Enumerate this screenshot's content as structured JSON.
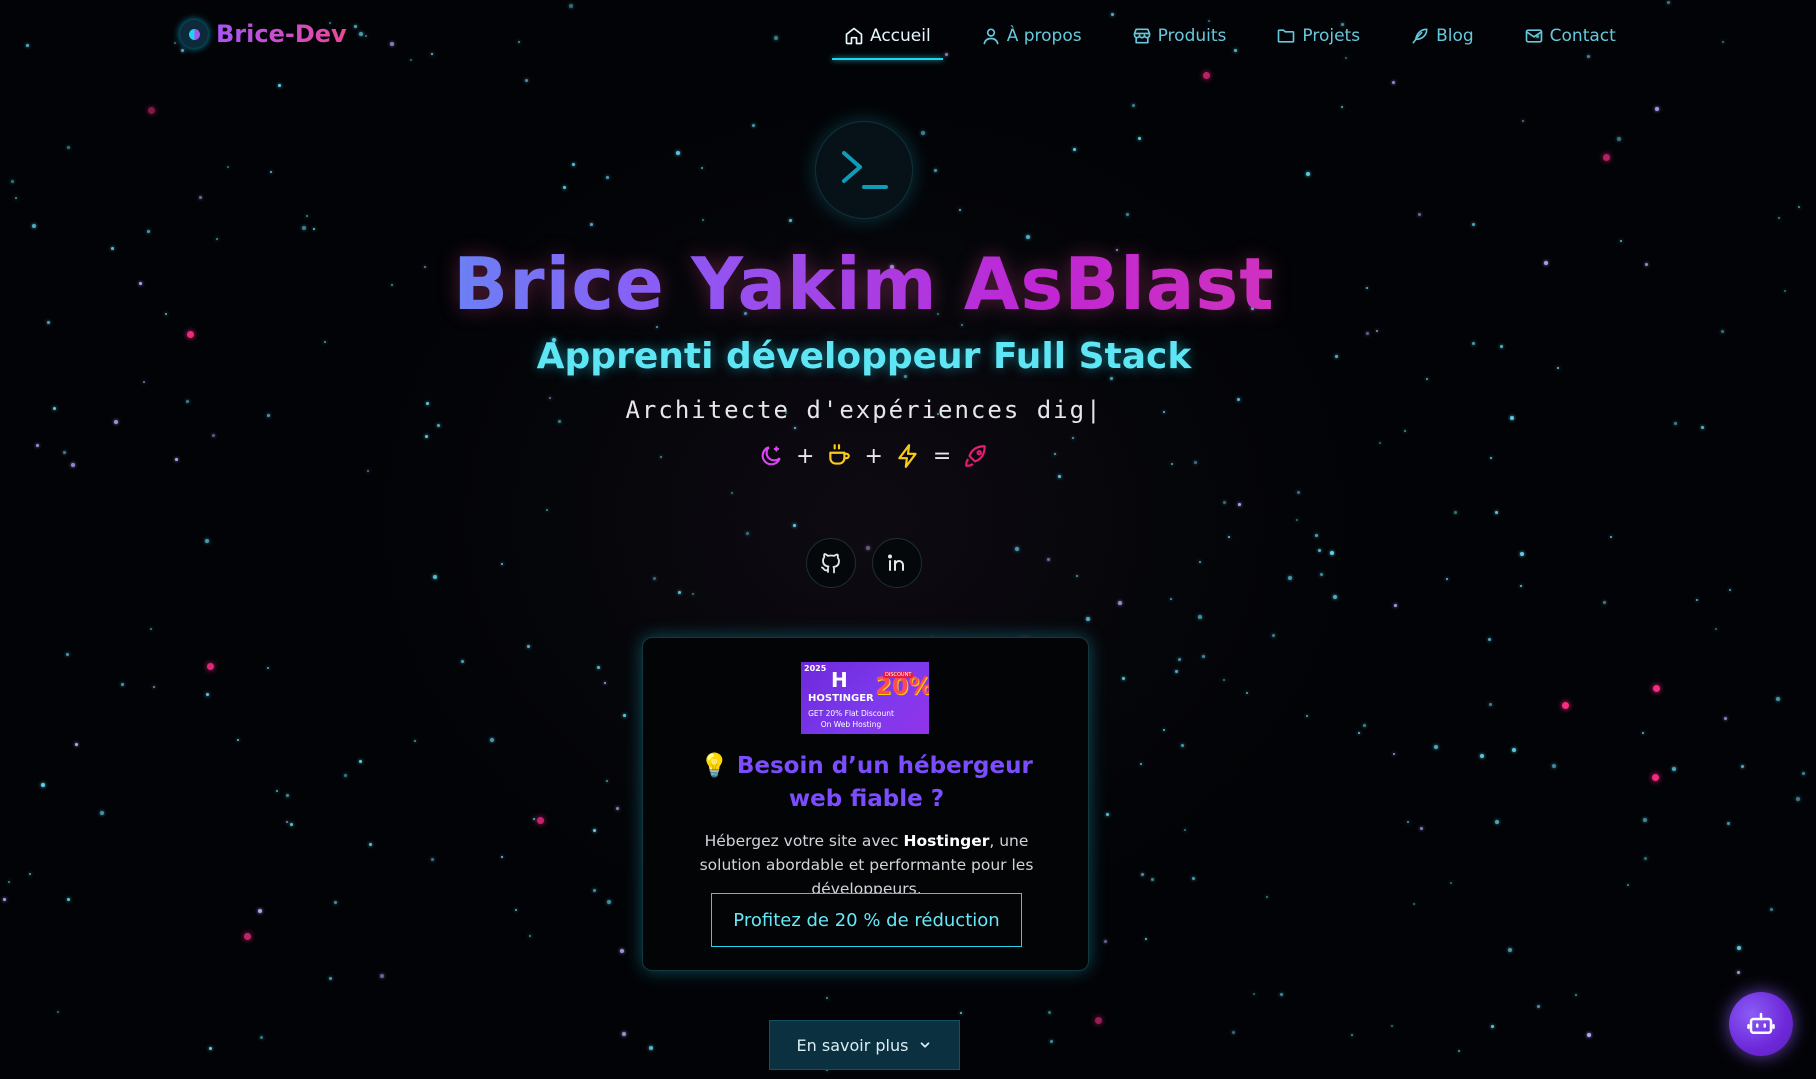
{
  "brand": {
    "name": "Brice-Dev"
  },
  "nav": {
    "items": [
      {
        "label": "Accueil",
        "icon": "home-icon",
        "active": true
      },
      {
        "label": "À propos",
        "icon": "user-icon"
      },
      {
        "label": "Produits",
        "icon": "store-icon"
      },
      {
        "label": "Projets",
        "icon": "folder-icon"
      },
      {
        "label": "Blog",
        "icon": "feather-icon"
      },
      {
        "label": "Contact",
        "icon": "mail-icon"
      }
    ]
  },
  "hero": {
    "name": "Brice Yakim AsBlast",
    "role": "Apprenti développeur Full Stack",
    "tagline": "Architecte d'expériences dig|",
    "formula": {
      "plus1": "+",
      "plus2": "+",
      "equals": "="
    }
  },
  "promo": {
    "banner": {
      "year": "2025",
      "brand": "HOSTINGER",
      "discount_label": "DISCOUNT",
      "discount": "20%",
      "line1": "GET 20% Flat Discount",
      "line2": "On Web Hosting"
    },
    "title": "💡 Besoin d’un hébergeur web fiable ?",
    "text_before": "Hébergez votre site avec ",
    "text_bold": "Hostinger",
    "text_after": ", une solution abordable et performante pour les développeurs.",
    "button": "Profitez de 20 % de réduction"
  },
  "more_button": "En savoir plus",
  "colors": {
    "accent": "#22d3ee",
    "purple": "#8b5cf6",
    "pink": "#ec4899"
  }
}
